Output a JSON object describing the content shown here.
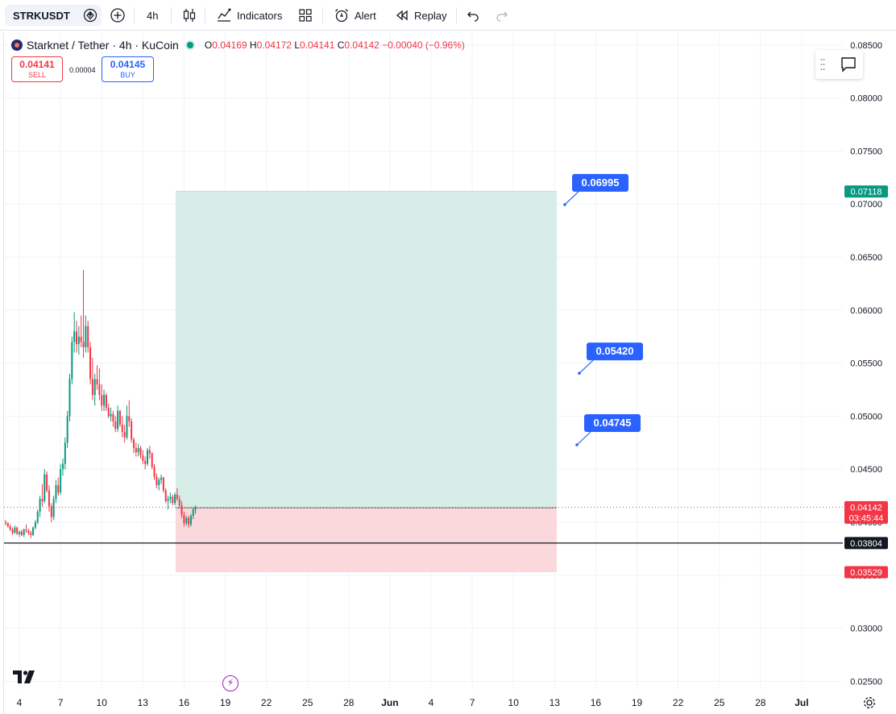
{
  "toolbar": {
    "symbol": "STRKUSDT",
    "interval": "4h",
    "indicators_label": "Indicators",
    "alert_label": "Alert",
    "replay_label": "Replay"
  },
  "legend": {
    "title": "Starknet / Tether · 4h · KuCoin",
    "o_key": "O",
    "o": "0.04169",
    "h_key": "H",
    "h": "0.04172",
    "l_key": "L",
    "l": "0.04141",
    "c_key": "C",
    "c": "0.04142",
    "change": "−0.00040 (−0.96%)"
  },
  "trade": {
    "sell_price": "0.04141",
    "sell_label": "SELL",
    "buy_price": "0.04145",
    "buy_label": "BUY",
    "spread": "0.00004"
  },
  "colors": {
    "up": "#089981",
    "down": "#f23645",
    "accent": "#2962ff",
    "profit_zone": "#d4ede6",
    "loss_zone": "#fad6da"
  },
  "icons": [
    "diamond-up-icon",
    "plus-circle-icon",
    "candles-icon",
    "indicators-icon",
    "layout-grid-icon",
    "alarm-clock-icon",
    "replay-icon",
    "undo-icon",
    "redo-icon",
    "comment-icon",
    "settings-gear-icon",
    "flash-icon"
  ],
  "chart_data": {
    "type": "candlestick",
    "ylim": [
      0.0242,
      0.0862
    ],
    "y_ticks": [
      "0.02500",
      "0.03000",
      "0.03500",
      "0.04000",
      "0.04500",
      "0.05000",
      "0.05500",
      "0.06000",
      "0.06500",
      "0.07000",
      "0.07500",
      "0.08000",
      "0.08500"
    ],
    "x_ticks": [
      "4",
      "7",
      "10",
      "13",
      "16",
      "19",
      "22",
      "25",
      "28",
      "Jun",
      "4",
      "7",
      "10",
      "13",
      "16",
      "19",
      "22",
      "25",
      "28",
      "Jul"
    ],
    "ohlc": [
      [
        0.04,
        0.0402,
        0.0397,
        0.0399
      ],
      [
        0.0399,
        0.04,
        0.0395,
        0.0396
      ],
      [
        0.0396,
        0.0398,
        0.0392,
        0.0393
      ],
      [
        0.0393,
        0.0395,
        0.0388,
        0.039
      ],
      [
        0.039,
        0.0397,
        0.0389,
        0.0395
      ],
      [
        0.0395,
        0.0396,
        0.0388,
        0.0389
      ],
      [
        0.0389,
        0.0392,
        0.0386,
        0.0391
      ],
      [
        0.0391,
        0.0393,
        0.0387,
        0.0388
      ],
      [
        0.0388,
        0.0394,
        0.0386,
        0.0393
      ],
      [
        0.0393,
        0.0398,
        0.039,
        0.0392
      ],
      [
        0.0392,
        0.0394,
        0.0388,
        0.039
      ],
      [
        0.039,
        0.0392,
        0.0385,
        0.0388
      ],
      [
        0.0388,
        0.0396,
        0.0387,
        0.0395
      ],
      [
        0.0395,
        0.0402,
        0.0393,
        0.04
      ],
      [
        0.04,
        0.0412,
        0.0398,
        0.041
      ],
      [
        0.041,
        0.0425,
        0.0405,
        0.0422
      ],
      [
        0.0422,
        0.0436,
        0.0415,
        0.042
      ],
      [
        0.042,
        0.045,
        0.0418,
        0.0445
      ],
      [
        0.0445,
        0.0448,
        0.0428,
        0.043
      ],
      [
        0.043,
        0.0435,
        0.041,
        0.0415
      ],
      [
        0.0415,
        0.0418,
        0.04,
        0.0405
      ],
      [
        0.0405,
        0.0425,
        0.0402,
        0.0422
      ],
      [
        0.0422,
        0.044,
        0.0418,
        0.0435
      ],
      [
        0.0435,
        0.0442,
        0.0425,
        0.0428
      ],
      [
        0.0428,
        0.0455,
        0.0426,
        0.045
      ],
      [
        0.045,
        0.046,
        0.0444,
        0.0455
      ],
      [
        0.0455,
        0.048,
        0.045,
        0.0475
      ],
      [
        0.0475,
        0.0505,
        0.047,
        0.05
      ],
      [
        0.05,
        0.054,
        0.0495,
        0.0535
      ],
      [
        0.0535,
        0.0575,
        0.053,
        0.057
      ],
      [
        0.057,
        0.0598,
        0.056,
        0.058
      ],
      [
        0.058,
        0.059,
        0.056,
        0.0568
      ],
      [
        0.0568,
        0.0585,
        0.0558,
        0.0575
      ],
      [
        0.0575,
        0.0595,
        0.0565,
        0.057
      ],
      [
        0.057,
        0.0638,
        0.0555,
        0.0565
      ],
      [
        0.0565,
        0.0595,
        0.056,
        0.0585
      ],
      [
        0.0585,
        0.059,
        0.056,
        0.0565
      ],
      [
        0.0565,
        0.057,
        0.053,
        0.0535
      ],
      [
        0.0535,
        0.0555,
        0.0515,
        0.052
      ],
      [
        0.052,
        0.054,
        0.051,
        0.0535
      ],
      [
        0.0535,
        0.0548,
        0.0525,
        0.053
      ],
      [
        0.053,
        0.0545,
        0.0515,
        0.052
      ],
      [
        0.052,
        0.053,
        0.0505,
        0.051
      ],
      [
        0.051,
        0.0525,
        0.0505,
        0.052
      ],
      [
        0.052,
        0.0522,
        0.0505,
        0.0508
      ],
      [
        0.0508,
        0.0512,
        0.0498,
        0.05
      ],
      [
        0.05,
        0.0508,
        0.0495,
        0.0502
      ],
      [
        0.0502,
        0.0505,
        0.049,
        0.0495
      ],
      [
        0.0495,
        0.05,
        0.0485,
        0.0488
      ],
      [
        0.0488,
        0.051,
        0.0485,
        0.0505
      ],
      [
        0.0505,
        0.0506,
        0.049,
        0.0492
      ],
      [
        0.0492,
        0.05,
        0.048,
        0.0485
      ],
      [
        0.0485,
        0.0492,
        0.0475,
        0.048
      ],
      [
        0.048,
        0.051,
        0.0478,
        0.05
      ],
      [
        0.05,
        0.0515,
        0.049,
        0.0495
      ],
      [
        0.0495,
        0.0498,
        0.0475,
        0.0478
      ],
      [
        0.0478,
        0.048,
        0.0465,
        0.047
      ],
      [
        0.047,
        0.0475,
        0.0462,
        0.0466
      ],
      [
        0.0466,
        0.0474,
        0.0462,
        0.047
      ],
      [
        0.047,
        0.0472,
        0.046,
        0.0463
      ],
      [
        0.0463,
        0.0468,
        0.0455,
        0.0458
      ],
      [
        0.0458,
        0.0462,
        0.045,
        0.0455
      ],
      [
        0.0455,
        0.047,
        0.0453,
        0.0468
      ],
      [
        0.0468,
        0.0472,
        0.046,
        0.0465
      ],
      [
        0.0465,
        0.0466,
        0.045,
        0.0452
      ],
      [
        0.0452,
        0.0455,
        0.044,
        0.0443
      ],
      [
        0.0443,
        0.0446,
        0.0432,
        0.0435
      ],
      [
        0.0435,
        0.0442,
        0.043,
        0.044
      ],
      [
        0.044,
        0.0445,
        0.0436,
        0.0442
      ],
      [
        0.0442,
        0.0443,
        0.0428,
        0.043
      ],
      [
        0.043,
        0.0432,
        0.0418,
        0.042
      ],
      [
        0.042,
        0.0425,
        0.0412,
        0.0422
      ],
      [
        0.0422,
        0.0428,
        0.0418,
        0.0424
      ],
      [
        0.0424,
        0.0426,
        0.0416,
        0.0418
      ],
      [
        0.0418,
        0.0428,
        0.0416,
        0.0426
      ],
      [
        0.0426,
        0.0432,
        0.042,
        0.0422
      ],
      [
        0.0422,
        0.0425,
        0.0414,
        0.0416
      ],
      [
        0.0416,
        0.042,
        0.0404,
        0.0407
      ],
      [
        0.0407,
        0.041,
        0.0396,
        0.0399
      ],
      [
        0.0399,
        0.0406,
        0.0397,
        0.0404
      ],
      [
        0.0404,
        0.0406,
        0.0395,
        0.0398
      ],
      [
        0.0398,
        0.0408,
        0.0396,
        0.0406
      ],
      [
        0.0406,
        0.0414,
        0.0403,
        0.0412
      ],
      [
        0.0412,
        0.0416,
        0.0408,
        0.0414
      ]
    ],
    "position": {
      "entry": 0.04135,
      "target": 0.07118,
      "stop": 0.03529,
      "current": 0.04142,
      "countdown": "03:45:44",
      "hline": 0.03804,
      "entry_label": "0.04135",
      "target_label": "0.07118",
      "stop_label": "0.03529",
      "current_label": "0.04142",
      "hline_label": "0.03804"
    },
    "callouts": [
      {
        "text": "0.06995",
        "value": 0.06995
      },
      {
        "text": "0.05420",
        "value": 0.0542
      },
      {
        "text": "0.04745",
        "value": 0.04745
      }
    ]
  }
}
